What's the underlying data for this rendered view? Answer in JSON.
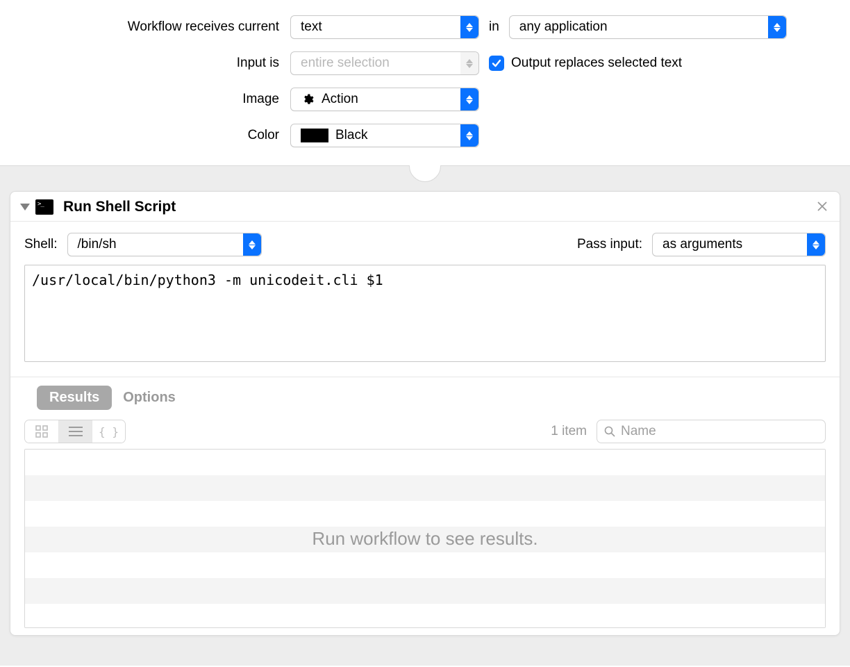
{
  "settings": {
    "receives_label": "Workflow receives current",
    "receives_value": "text",
    "in_word": "in",
    "application_value": "any application",
    "input_label": "Input is",
    "input_value": "entire selection",
    "output_checkbox_label": "Output replaces selected text",
    "image_label": "Image",
    "image_value": "Action",
    "color_label": "Color",
    "color_value": "Black"
  },
  "action": {
    "title": "Run Shell Script",
    "shell_label": "Shell:",
    "shell_value": "/bin/sh",
    "pass_input_label": "Pass input:",
    "pass_input_value": "as arguments",
    "script": "/usr/local/bin/python3 -m unicodeit.cli $1",
    "tabs": {
      "results": "Results",
      "options": "Options"
    },
    "results": {
      "item_count": "1 item",
      "search_placeholder": "Name",
      "placeholder": "Run workflow to see results."
    }
  }
}
